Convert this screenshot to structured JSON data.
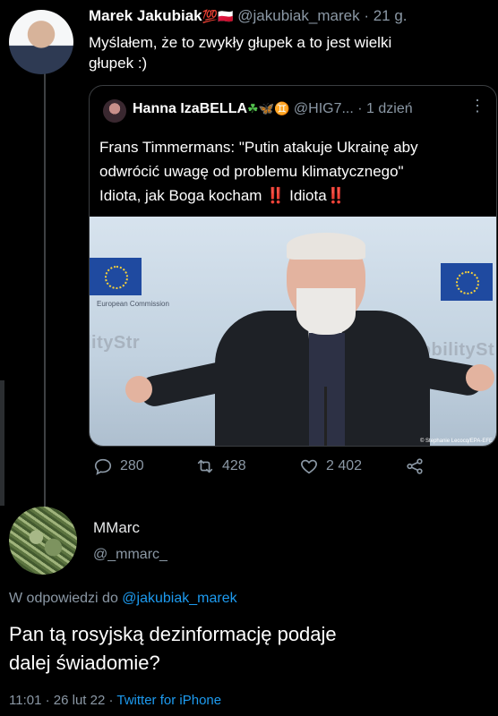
{
  "tweet": {
    "author_name": "Marek Jakubiak",
    "author_badges": "💯🇵🇱",
    "handle": "@jakubiak_marek",
    "time": "· 21 g.",
    "text_line1": "Myślałem, że to zwykły głupek a to  jest wielki",
    "text_line2": "głupek :)"
  },
  "quoted": {
    "author_name": "Hanna IzaBELLA",
    "author_badges": "☘🦋♊",
    "handle": "@HIG7...",
    "time": "· 1 dzień",
    "text_line1": "Frans Timmermans: \"Putin atakuje Ukrainę aby",
    "text_line2": "odwrócić uwagę od problemu klimatycznego\"",
    "text_line3": "Idiota, jak Boga kocham",
    "text_line3b": "Idiota",
    "exclaim": "‼️",
    "photo_text_left": "lityStr",
    "photo_text_right": "#MobilitySt",
    "eu_label": "European Commission",
    "photo_credit": "© Stephanie Lecocq/EPA-EFE"
  },
  "actions": {
    "replies": "280",
    "retweets": "428",
    "likes": "2 402"
  },
  "reply": {
    "author_name": "MMarc",
    "handle": "@_mmarc_",
    "reply_to_prefix": "W odpowiedzi do",
    "reply_to_handle": "@jakubiak_marek",
    "text_line1": "Pan tą rosyjską dezinformację podaje",
    "text_line2": "dalej świadomie?",
    "time": "11:01 · 26 lut 22 ·",
    "source": "Twitter for iPhone"
  },
  "icons": {
    "reply": "speech-bubble-icon",
    "retweet": "retweet-icon",
    "like": "heart-icon",
    "share": "share-icon",
    "more": "more-dots-icon"
  },
  "colors": {
    "link": "#1d9bf0",
    "muted": "#8b98a5",
    "background": "#000000"
  }
}
